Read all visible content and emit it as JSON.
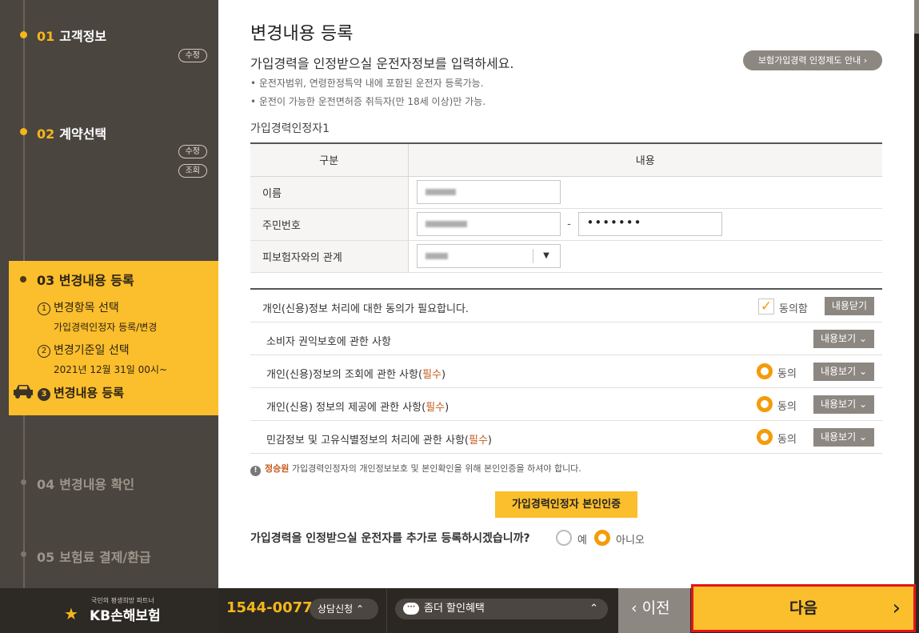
{
  "sidebar": {
    "steps": [
      {
        "num": "01",
        "label": "고객정보",
        "badges": [
          "수정"
        ]
      },
      {
        "num": "02",
        "label": "계약선택",
        "badges": [
          "수정",
          "조회"
        ]
      },
      {
        "num": "03",
        "label": "변경내용 등록"
      },
      {
        "num": "04",
        "label": "변경내용 확인"
      },
      {
        "num": "05",
        "label": "보험료 결제/환급"
      }
    ],
    "substeps": [
      {
        "num": "1",
        "label": "변경항목 선택",
        "desc": "가입경력인정자 등록/변경"
      },
      {
        "num": "2",
        "label": "변경기준일 선택",
        "desc": "2021년 12월 31일 00시~"
      },
      {
        "num": "3",
        "label": "변경내용 등록",
        "desc": ""
      }
    ]
  },
  "main": {
    "title": "변경내용 등록",
    "lead": "가입경력을 인정받으실 운전자정보를 입력하세요.",
    "guide_button": "보험가입경력 인정제도 안내 ›",
    "bullets": [
      "• 운전자범위, 연령한정특약 내에 포함된 운전자 등록가능.",
      "• 운전이 가능한 운전면허증 취득자(만 18세 이상)만 가능."
    ],
    "section_label": "가입경력인정자1",
    "table": {
      "headers": [
        "구분",
        "내용"
      ],
      "name_label": "이름",
      "rrn_label": "주민번호",
      "rrn_dash": "-",
      "rrn_back": "•••••••",
      "relation_label": "피보험자와의 관계"
    },
    "consent": {
      "main_text": "개인(신용)정보 처리에 대한 동의가 필요합니다.",
      "agree_all": "동의함",
      "close_btn": "내용닫기",
      "rows": [
        {
          "text": "소비자 권익보호에 관한 사항",
          "req": "",
          "suffix": "",
          "radio": false
        },
        {
          "text": "개인(신용)정보의 조회에 관한 사항(",
          "req": "필수",
          "suffix": ")",
          "radio": true
        },
        {
          "text": "개인(신용) 정보의 제공에 관한 사항(",
          "req": "필수",
          "suffix": ")",
          "radio": true
        },
        {
          "text": "민감정보 및 고유식별정보의 처리에 관한 사항(",
          "req": "필수",
          "suffix": ")",
          "radio": true
        }
      ],
      "agree_label": "동의",
      "view_btn": "내용보기 ⌄"
    },
    "notice_name": "정승원",
    "notice_text": " 가입경력인정자의 개인정보보호 및 본인확인을 위해 본인인증을 하셔야 합니다.",
    "cert_button": "가입경력인정자 본인인증",
    "add_question": "가입경력을 인정받으실 운전자를 추가로 등록하시겠습니까?",
    "add_yes": "예",
    "add_no": "아니오"
  },
  "bottom": {
    "logo_sub": "국민의 평생희망 파트너",
    "logo_main": "KB손해보험",
    "phone": "1544-0077",
    "consult": "상담신청",
    "discount": "좀더 할인혜택",
    "prev": "이전",
    "next": "다음"
  },
  "colors": {
    "accent": "#fbbe2c",
    "orange": "#f59b0a",
    "required": "#c75a1b",
    "highlight_border": "#e3141c"
  }
}
